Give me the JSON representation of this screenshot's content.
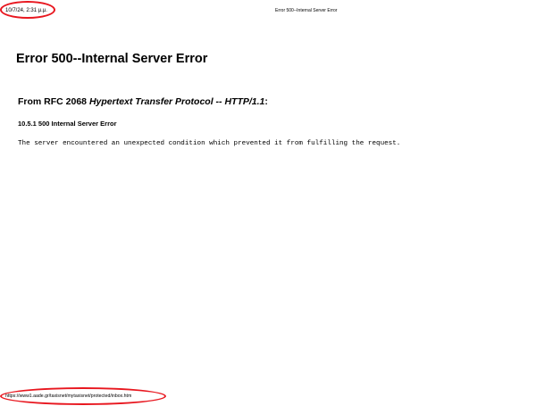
{
  "print_header": {
    "datetime": "10/7/24, 2:31 μ.μ.",
    "title": "Error 500--Internal Server Error"
  },
  "page": {
    "heading": "Error 500--Internal Server Error",
    "rfc_prefix": "From RFC 2068 ",
    "rfc_title": "Hypertext Transfer Protocol -- HTTP/1.1",
    "rfc_suffix": ":",
    "section_heading": "10.5.1 500 Internal Server Error",
    "message": "The server encountered an unexpected condition which prevented it from fulfilling the request."
  },
  "print_footer": {
    "url": "https://www1.aade.gr/taxisnet/mytaxisnet/protected/inbox.htm"
  },
  "annotations": {
    "color": "#e8171f"
  }
}
